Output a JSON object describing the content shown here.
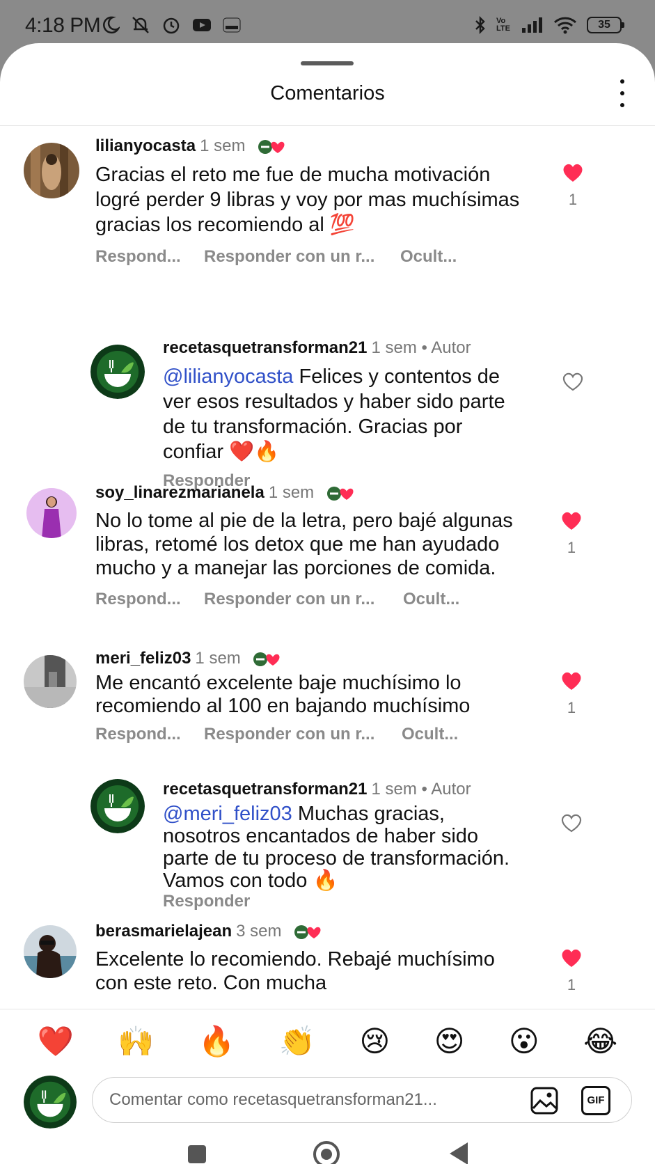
{
  "status_bar": {
    "time": "4:18 PM",
    "network_label": "Vo LTE",
    "battery": "35"
  },
  "sheet": {
    "title": "Comentarios"
  },
  "comments": [
    {
      "username": "lilianyocasta",
      "time": "1 sem",
      "text": "Gracias el reto me fue de mucha motivación logré perder 9 libras y voy por mas muchísimas gracias los recomiendo al 💯",
      "liked": true,
      "like_count": "1",
      "actions": [
        "Respond...",
        "Responder con un r...",
        "Ocult..."
      ]
    },
    {
      "username": "recetasquetransforman21",
      "time": "1 sem",
      "author_label": "• Autor",
      "mention": "@lilianyocasta",
      "text": " Felices y contentos de ver esos resultados y haber sido parte de tu transformación. Gracias por confiar ❤️🔥",
      "liked": false,
      "actions": [
        "Responder"
      ]
    },
    {
      "username": "soy_linarezmarianela",
      "time": "1 sem",
      "text": "No lo tome al pie de la letra, pero bajé algunas libras, retomé los detox que me han ayudado mucho y a manejar las porciones de comida.",
      "liked": true,
      "like_count": "1",
      "actions": [
        "Respond...",
        "Responder con un r...",
        "Ocult..."
      ]
    },
    {
      "username": "meri_feliz03",
      "time": "1 sem",
      "text": "Me encantó excelente baje muchísimo lo recomiendo al 100 en bajando muchísimo",
      "liked": true,
      "like_count": "1",
      "actions": [
        "Respond...",
        "Responder con un r...",
        "Ocult..."
      ]
    },
    {
      "username": "recetasquetransforman21",
      "time": "1 sem",
      "author_label": "• Autor",
      "mention": "@meri_feliz03",
      "text": " Muchas gracias, nosotros encantados de haber sido parte de tu proceso de transformación. Vamos con todo 🔥",
      "liked": false,
      "actions": [
        "Responder"
      ]
    },
    {
      "username": "berasmarielajean",
      "time": "3 sem",
      "text": "Excelente lo recomiendo. Rebajé muchísimo con este reto. Con mucha",
      "liked": true,
      "like_count": "1",
      "actions": []
    }
  ],
  "reactions": [
    "❤️",
    "🙌",
    "🔥",
    "👏",
    "😢",
    "😍",
    "😮",
    "😂"
  ],
  "composer": {
    "placeholder": "Comentar como recetasquetransforman21...",
    "gif_label": "GIF"
  },
  "colors": {
    "like_red": "#ff2d55",
    "mention_blue": "#3050c8",
    "brand_green": "#1e6b2a"
  }
}
